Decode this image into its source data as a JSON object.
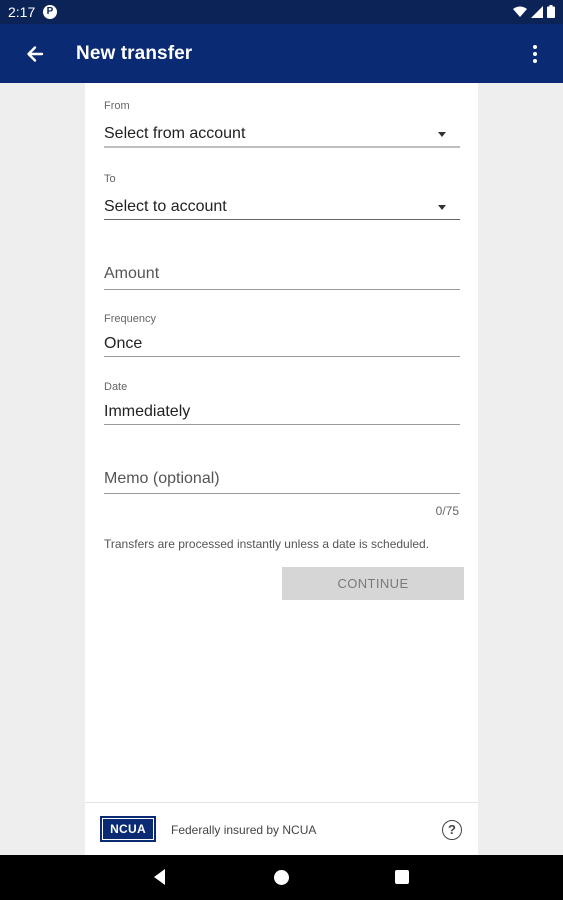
{
  "status": {
    "time": "2:17",
    "app_badge": "P"
  },
  "app_bar": {
    "title": "New transfer"
  },
  "form": {
    "from": {
      "label": "From",
      "value": "Select from account"
    },
    "to": {
      "label": "To",
      "value": "Select to account"
    },
    "amount": {
      "placeholder": "Amount"
    },
    "frequency": {
      "label": "Frequency",
      "value": "Once"
    },
    "date": {
      "label": "Date",
      "value": "Immediately"
    },
    "memo": {
      "placeholder": "Memo (optional)",
      "counter": "0/75"
    },
    "hint": "Transfers are processed instantly unless a date is scheduled.",
    "continue_label": "CONTINUE"
  },
  "footer": {
    "logo_text": "NCUA",
    "text": "Federally insured by NCUA",
    "help_glyph": "?"
  },
  "colors": {
    "app_bar": "#0a2a73",
    "status_bar": "#0c2357",
    "button_disabled": "#d6d6d6"
  }
}
